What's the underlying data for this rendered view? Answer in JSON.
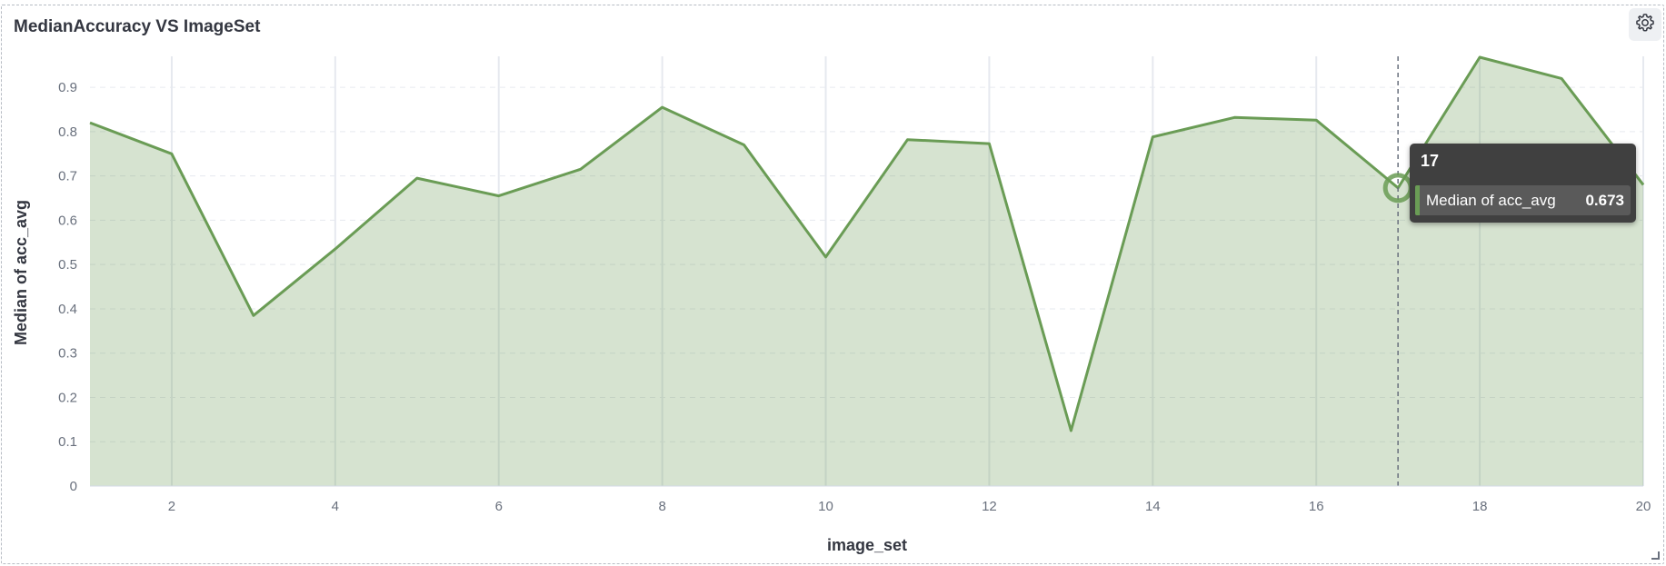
{
  "panel": {
    "title": "MedianAccuracy VS ImageSet",
    "settings_icon": "gear-icon"
  },
  "chart_data": {
    "type": "area",
    "title": "MedianAccuracy VS ImageSet",
    "xlabel": "image_set",
    "ylabel": "Median of acc_avg",
    "x": [
      1,
      2,
      3,
      4,
      5,
      6,
      7,
      8,
      9,
      10,
      11,
      12,
      13,
      14,
      15,
      16,
      17,
      18,
      19,
      20
    ],
    "series": [
      {
        "name": "Median of acc_avg",
        "color": "#6a9c55",
        "fill_color": "#d5e4d0",
        "values": [
          0.82,
          0.75,
          0.385,
          0.535,
          0.695,
          0.655,
          0.715,
          0.855,
          0.77,
          0.517,
          0.782,
          0.773,
          0.125,
          0.788,
          0.832,
          0.826,
          0.673,
          0.968,
          0.92,
          0.68
        ]
      }
    ],
    "xlim": [
      1,
      20
    ],
    "ylim": [
      0,
      0.97
    ],
    "xticks": [
      2,
      4,
      6,
      8,
      10,
      12,
      14,
      16,
      18,
      20
    ],
    "yticks": [
      0,
      0.1,
      0.2,
      0.3,
      0.4,
      0.5,
      0.6,
      0.7,
      0.8,
      0.9
    ],
    "grid": true,
    "hover": {
      "x": 17,
      "series": "Median of acc_avg",
      "value": "0.673"
    }
  },
  "tooltip": {
    "header": "17",
    "label": "Median of acc_avg",
    "value": "0.673"
  }
}
